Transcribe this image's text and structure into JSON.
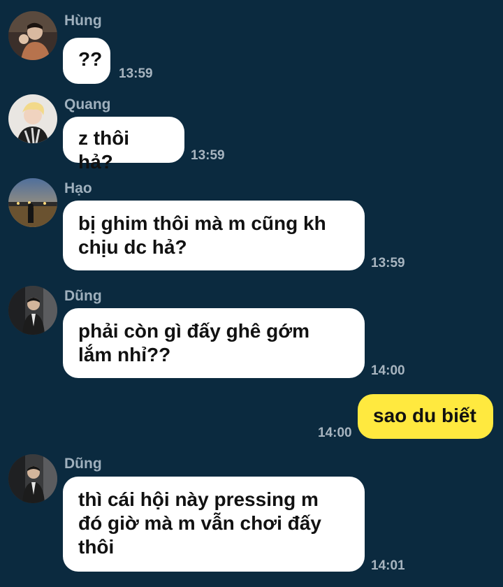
{
  "colors": {
    "background": "#0b2a3f",
    "incoming_bubble": "#ffffff",
    "outgoing_bubble": "#ffe93f",
    "sender_name": "#9fb0bd",
    "timestamp": "#a7b4bf"
  },
  "messages": [
    {
      "sender": "Hùng",
      "text": "??",
      "time": "13:59",
      "avatar_icon": "avatar-hung-icon"
    },
    {
      "sender": "Quang",
      "text": "z thôi hả?",
      "time": "13:59",
      "avatar_icon": "avatar-quang-icon"
    },
    {
      "sender": "Hạo",
      "text": "bị ghim thôi mà m cũng kh\nchịu dc hả?",
      "time": "13:59",
      "avatar_icon": "avatar-hao-icon"
    },
    {
      "sender": "Dũng",
      "text": "phải còn gì đấy ghê gớm\nlắm nhỉ??",
      "time": "14:00",
      "avatar_icon": "avatar-dung-icon"
    },
    {
      "sender": "",
      "text": "sao du biết",
      "time": "14:00",
      "outgoing": true
    },
    {
      "sender": "Dũng",
      "text": "thì cái hội này pressing m\nđó giờ mà m vẫn chơi đấy\nthôi",
      "time": "14:01",
      "avatar_icon": "avatar-dung-icon"
    }
  ]
}
